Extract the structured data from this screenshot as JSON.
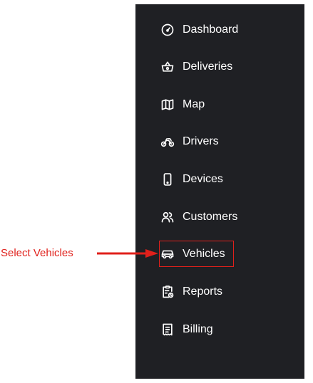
{
  "sidebar": {
    "items": [
      {
        "label": "Dashboard",
        "icon": "gauge-icon"
      },
      {
        "label": "Deliveries",
        "icon": "basket-icon"
      },
      {
        "label": "Map",
        "icon": "map-icon"
      },
      {
        "label": "Drivers",
        "icon": "motorcycle-icon"
      },
      {
        "label": "Devices",
        "icon": "phone-icon"
      },
      {
        "label": "Customers",
        "icon": "users-icon"
      },
      {
        "label": "Vehicles",
        "icon": "car-icon"
      },
      {
        "label": "Reports",
        "icon": "report-icon"
      },
      {
        "label": "Billing",
        "icon": "receipt-icon"
      }
    ]
  },
  "annotation": {
    "label": "Select Vehicles",
    "color": "#e0201b"
  },
  "colors": {
    "sidebar_bg": "#1f2024",
    "text": "#ffffff"
  }
}
